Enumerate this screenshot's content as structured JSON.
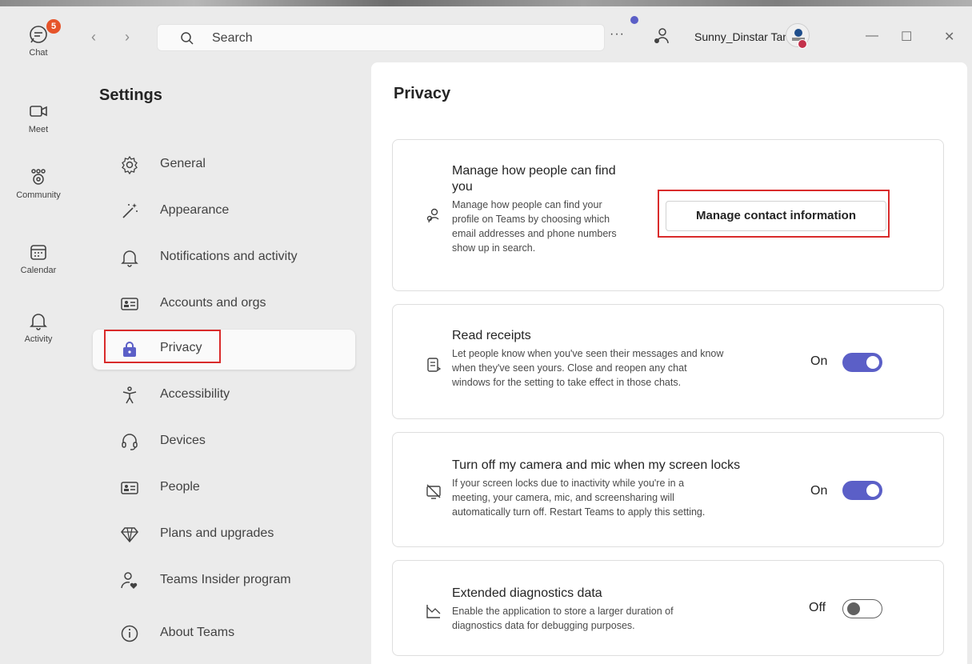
{
  "rail": {
    "chat": {
      "label": "Chat",
      "badge": "5"
    },
    "meet": {
      "label": "Meet"
    },
    "community": {
      "label": "Community"
    },
    "calendar": {
      "label": "Calendar"
    },
    "activity": {
      "label": "Activity"
    }
  },
  "titlebar": {
    "search_placeholder": "Search",
    "more_label": "···",
    "user_name": "Sunny_Dinstar Tan",
    "minimize": "—",
    "maximize": "☐",
    "close": "✕",
    "back": "‹",
    "forward": "›"
  },
  "settings": {
    "title": "Settings",
    "items": [
      {
        "label": "General",
        "icon": "gear-icon"
      },
      {
        "label": "Appearance",
        "icon": "magic-wand-icon"
      },
      {
        "label": "Notifications and activity",
        "icon": "bell-icon"
      },
      {
        "label": "Accounts and orgs",
        "icon": "id-card-icon"
      },
      {
        "label": "Privacy",
        "icon": "lock-icon",
        "active": true
      },
      {
        "label": "Accessibility",
        "icon": "accessibility-icon"
      },
      {
        "label": "Devices",
        "icon": "headset-icon"
      },
      {
        "label": "People",
        "icon": "contact-card-icon"
      },
      {
        "label": "Plans and upgrades",
        "icon": "diamond-icon"
      },
      {
        "label": "Teams Insider program",
        "icon": "person-heart-icon"
      },
      {
        "label": "About Teams",
        "icon": "info-icon"
      }
    ]
  },
  "privacy": {
    "title": "Privacy",
    "find_you": {
      "title_line1": "Manage how people can find",
      "title_line2": "you",
      "desc_lines": [
        "Manage how people can find your",
        "profile on Teams by choosing which",
        "email addresses and phone numbers",
        "show up in search."
      ],
      "button_label": "Manage contact information"
    },
    "read_receipts": {
      "title": "Read receipts",
      "desc_lines": [
        "Let people know when you've seen their messages and know",
        "when they've seen yours. Close and reopen any chat",
        "windows for the setting to take effect in those chats."
      ],
      "state_label": "On",
      "enabled": true
    },
    "camera_mic": {
      "title": "Turn off my camera and mic when my screen locks",
      "desc_lines": [
        "If your screen locks due to inactivity while you're in a",
        "meeting, your camera, mic, and screensharing will",
        "automatically turn off. Restart Teams to apply this setting."
      ],
      "state_label": "On",
      "enabled": true
    },
    "diagnostics": {
      "title": "Extended diagnostics data",
      "desc_lines": [
        "Enable the application to store a larger duration of",
        "diagnostics data for debugging purposes."
      ],
      "state_label": "Off",
      "enabled": false
    }
  },
  "colors": {
    "accent": "#5b5fc7",
    "highlight": "#d92b2b",
    "badge": "#e6542a"
  }
}
